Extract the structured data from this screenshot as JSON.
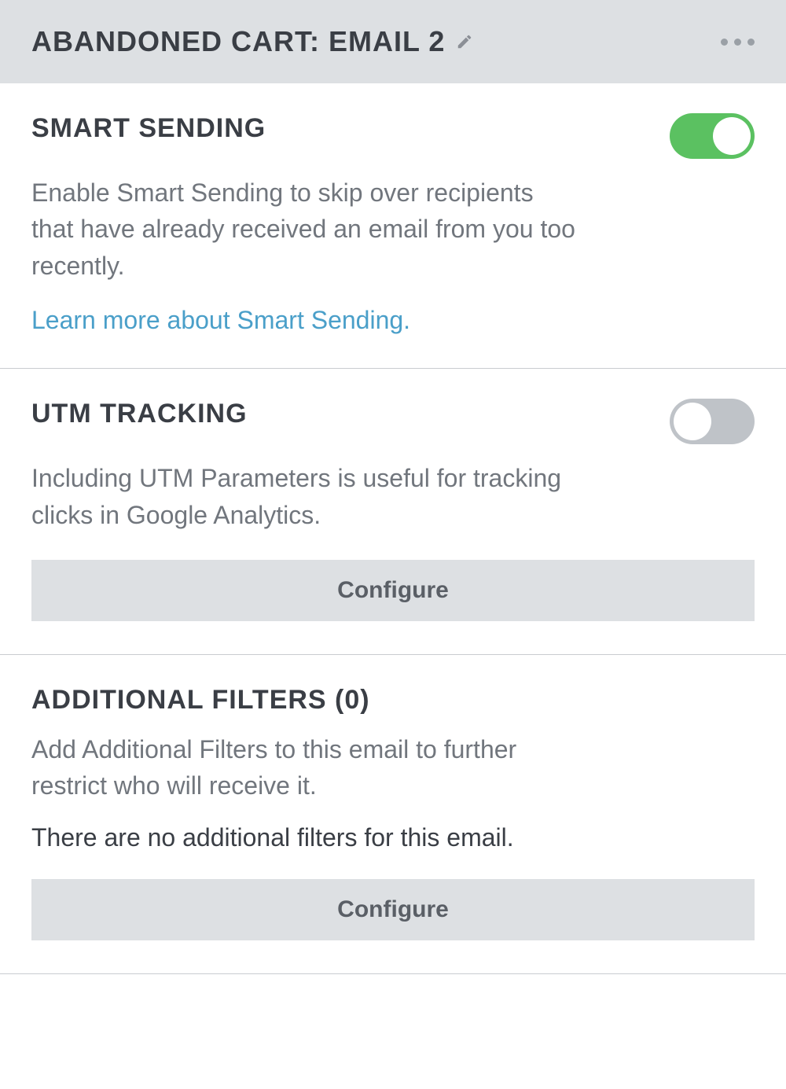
{
  "header": {
    "title": "ABANDONED CART: EMAIL 2"
  },
  "sections": {
    "smart_sending": {
      "title": "SMART SENDING",
      "description": "Enable Smart Sending to skip over recipients that have already received an email from you too recently.",
      "link_text": "Learn more about Smart Sending.",
      "toggle_on": true
    },
    "utm_tracking": {
      "title": "UTM TRACKING",
      "description": "Including UTM Parameters is useful for tracking clicks in Google Analytics.",
      "button_label": "Configure",
      "toggle_on": false
    },
    "additional_filters": {
      "title": "ADDITIONAL FILTERS (0)",
      "description": "Add Additional Filters to this email to further restrict who will receive it.",
      "note": "There are no additional filters for this email.",
      "button_label": "Configure"
    }
  }
}
